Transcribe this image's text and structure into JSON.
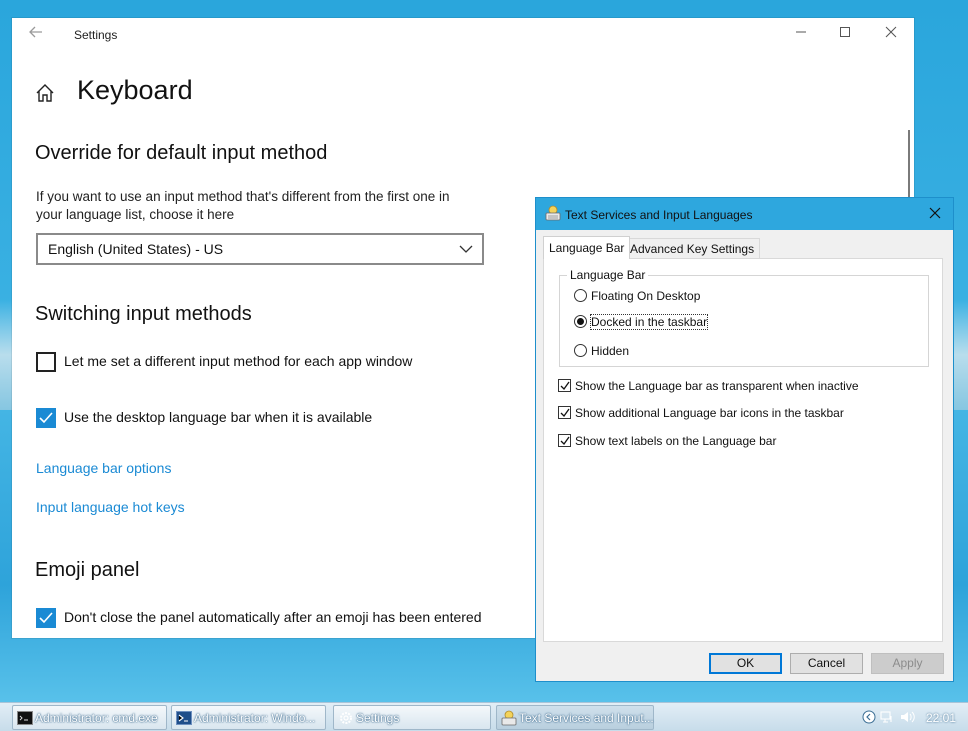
{
  "settings": {
    "window_title": "Settings",
    "page_title": "Keyboard",
    "override_heading": "Override for default input method",
    "override_desc_line1": "If you want to use an input method that's different from the first one in",
    "override_desc_line2": "your language list, choose it here",
    "input_method_selected": "English (United States) - US",
    "switching_heading": "Switching input methods",
    "checkbox_per_app": {
      "label": "Let me set a different input method for each app window",
      "checked": false
    },
    "checkbox_desktop_bar": {
      "label": "Use the desktop language bar when it is available",
      "checked": true
    },
    "link_language_bar_options": "Language bar options",
    "link_hot_keys": "Input language hot keys",
    "emoji_heading": "Emoji panel",
    "checkbox_emoji": {
      "label": "Don't close the panel automatically after an emoji has been entered",
      "checked": true
    }
  },
  "dialog": {
    "title": "Text Services and Input Languages",
    "tabs": [
      {
        "label": "Language Bar",
        "active": true
      },
      {
        "label": "Advanced Key Settings",
        "active": false
      }
    ],
    "group_label": "Language Bar",
    "radios": [
      {
        "label": "Floating On Desktop",
        "checked": false
      },
      {
        "label": "Docked in the taskbar",
        "checked": true
      },
      {
        "label": "Hidden",
        "checked": false
      }
    ],
    "checkboxes": [
      {
        "label": "Show the Language bar as transparent when inactive",
        "checked": true
      },
      {
        "label": "Show additional Language bar icons in the taskbar",
        "checked": true
      },
      {
        "label": "Show text labels on the Language bar",
        "checked": true
      }
    ],
    "buttons": {
      "ok": "OK",
      "cancel": "Cancel",
      "apply": "Apply"
    }
  },
  "taskbar": {
    "items": [
      {
        "label": "Administrator: cmd.exe",
        "icon": "cmd-icon"
      },
      {
        "label": "Administrator: Windo...",
        "icon": "powershell-icon"
      },
      {
        "label": "Settings",
        "icon": "gear-icon"
      },
      {
        "label": "Text Services and Input...",
        "icon": "keyboard-icon"
      }
    ],
    "clock": "22:01"
  },
  "colors": {
    "accent": "#1a8ad4",
    "dialog_titlebar": "#2ea7de",
    "taskbar": "#c7dcea"
  }
}
